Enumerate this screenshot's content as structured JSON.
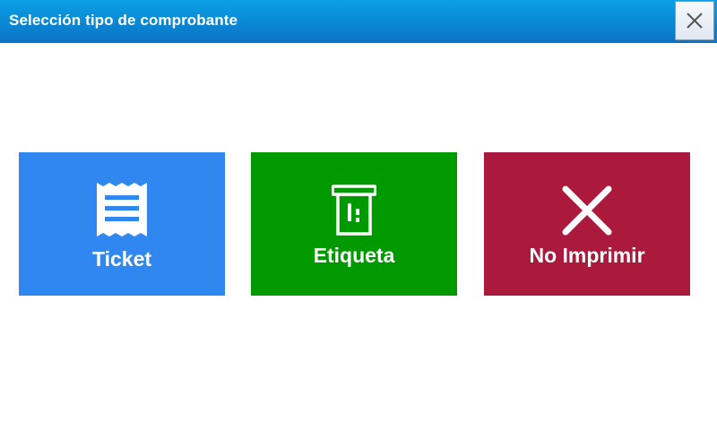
{
  "dialog": {
    "title": "Selección tipo de comprobante",
    "close_icon": "close-icon"
  },
  "options": [
    {
      "label": "Ticket",
      "icon": "receipt-icon",
      "color": "#3087ef"
    },
    {
      "label": "Etiqueta",
      "icon": "label-printer-icon",
      "color": "#009a00"
    },
    {
      "label": "No Imprimir",
      "icon": "close-x-icon",
      "color": "#ab1a3c"
    }
  ],
  "colors": {
    "titlebar": "#0b86d3",
    "title_text": "#ffffff",
    "background": "#ffffff"
  }
}
